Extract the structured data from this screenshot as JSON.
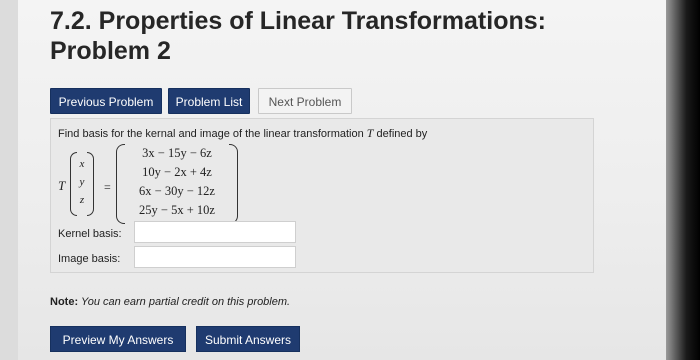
{
  "header": {
    "title_line1": "7.2. Properties of Linear Transformations:",
    "title_line2": "Problem 2"
  },
  "nav": {
    "previous_label": "Previous Problem",
    "list_label": "Problem List",
    "next_label": "Next Problem"
  },
  "problem": {
    "prompt_before": "Find basis for the kernal and image of the linear transformation ",
    "prompt_symbol": "T",
    "prompt_after": " defined by",
    "map_symbol": "T",
    "input_vector": [
      "x",
      "y",
      "z"
    ],
    "equals": "=",
    "output_rows": [
      "3x − 15y − 6z",
      "10y − 2x + 4z",
      "6x − 30y − 12z",
      "25y − 5x + 10z"
    ]
  },
  "fields": {
    "kernel_label": "Kernel basis:",
    "kernel_value": "",
    "image_label": "Image basis:",
    "image_value": ""
  },
  "note": {
    "bold": "Note:",
    "text": " You can earn partial credit on this problem."
  },
  "actions": {
    "preview_label": "Preview My Answers",
    "submit_label": "Submit Answers"
  },
  "colors": {
    "button_primary": "#1f3b70",
    "background": "#ededed"
  }
}
